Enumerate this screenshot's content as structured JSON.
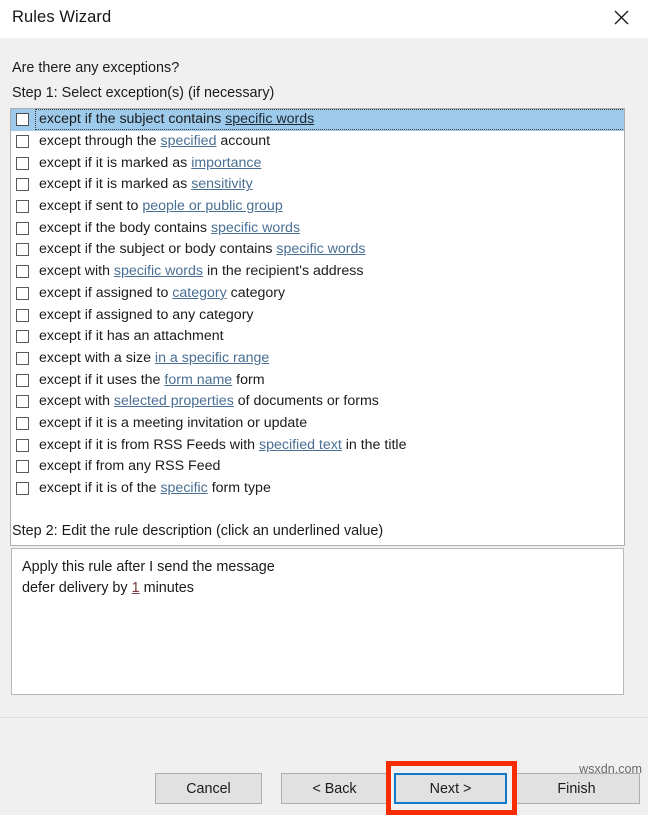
{
  "window": {
    "title": "Rules Wizard",
    "close_icon": "close-icon"
  },
  "content": {
    "prompt": "Are there any exceptions?",
    "step1_label": "Step 1: Select exception(s) (if necessary)",
    "step2_label": "Step 2: Edit the rule description (click an underlined value)"
  },
  "exceptions": [
    {
      "checked": false,
      "selected": true,
      "parts": [
        {
          "t": "except if the subject contains ",
          "link": false
        },
        {
          "t": "specific words",
          "link": true
        }
      ]
    },
    {
      "checked": false,
      "selected": false,
      "parts": [
        {
          "t": "except through the ",
          "link": false
        },
        {
          "t": "specified",
          "link": true
        },
        {
          "t": " account",
          "link": false
        }
      ]
    },
    {
      "checked": false,
      "selected": false,
      "parts": [
        {
          "t": "except if it is marked as ",
          "link": false
        },
        {
          "t": "importance",
          "link": true
        }
      ]
    },
    {
      "checked": false,
      "selected": false,
      "parts": [
        {
          "t": "except if it is marked as ",
          "link": false
        },
        {
          "t": "sensitivity",
          "link": true
        }
      ]
    },
    {
      "checked": false,
      "selected": false,
      "parts": [
        {
          "t": "except if sent to ",
          "link": false
        },
        {
          "t": "people or public group",
          "link": true
        }
      ]
    },
    {
      "checked": false,
      "selected": false,
      "parts": [
        {
          "t": "except if the body contains ",
          "link": false
        },
        {
          "t": "specific words",
          "link": true
        }
      ]
    },
    {
      "checked": false,
      "selected": false,
      "parts": [
        {
          "t": "except if the subject or body contains ",
          "link": false
        },
        {
          "t": "specific words",
          "link": true
        }
      ]
    },
    {
      "checked": false,
      "selected": false,
      "parts": [
        {
          "t": "except with ",
          "link": false
        },
        {
          "t": "specific words",
          "link": true
        },
        {
          "t": " in the recipient's address",
          "link": false
        }
      ]
    },
    {
      "checked": false,
      "selected": false,
      "parts": [
        {
          "t": "except if assigned to ",
          "link": false
        },
        {
          "t": "category",
          "link": true
        },
        {
          "t": " category",
          "link": false
        }
      ]
    },
    {
      "checked": false,
      "selected": false,
      "parts": [
        {
          "t": "except if assigned to any category",
          "link": false
        }
      ]
    },
    {
      "checked": false,
      "selected": false,
      "parts": [
        {
          "t": "except if it has an attachment",
          "link": false
        }
      ]
    },
    {
      "checked": false,
      "selected": false,
      "parts": [
        {
          "t": "except with a size ",
          "link": false
        },
        {
          "t": "in a specific range",
          "link": true
        }
      ]
    },
    {
      "checked": false,
      "selected": false,
      "parts": [
        {
          "t": "except if it uses the ",
          "link": false
        },
        {
          "t": "form name",
          "link": true
        },
        {
          "t": " form",
          "link": false
        }
      ]
    },
    {
      "checked": false,
      "selected": false,
      "parts": [
        {
          "t": "except with ",
          "link": false
        },
        {
          "t": "selected properties",
          "link": true
        },
        {
          "t": " of documents or forms",
          "link": false
        }
      ]
    },
    {
      "checked": false,
      "selected": false,
      "parts": [
        {
          "t": "except if it is a meeting invitation or update",
          "link": false
        }
      ]
    },
    {
      "checked": false,
      "selected": false,
      "parts": [
        {
          "t": "except if it is from RSS Feeds with ",
          "link": false
        },
        {
          "t": "specified text",
          "link": true
        },
        {
          "t": " in the title",
          "link": false
        }
      ]
    },
    {
      "checked": false,
      "selected": false,
      "parts": [
        {
          "t": "except if from any RSS Feed",
          "link": false
        }
      ]
    },
    {
      "checked": false,
      "selected": false,
      "parts": [
        {
          "t": "except if it is of the ",
          "link": false
        },
        {
          "t": "specific",
          "link": true
        },
        {
          "t": " form type",
          "link": false
        }
      ]
    }
  ],
  "description_lines": [
    [
      {
        "t": "Apply this rule after I send the message",
        "link": false
      }
    ],
    [
      {
        "t": "defer delivery by ",
        "link": false
      },
      {
        "t": "1",
        "link": true
      },
      {
        "t": " minutes",
        "link": false
      }
    ]
  ],
  "buttons": {
    "cancel": "Cancel",
    "back": "< Back",
    "next": "Next >",
    "finish": "Finish"
  },
  "annotation": {
    "highlight_color": "#f62d00",
    "focus_color": "#0f7ac7"
  },
  "watermark": "wsxdn.com"
}
